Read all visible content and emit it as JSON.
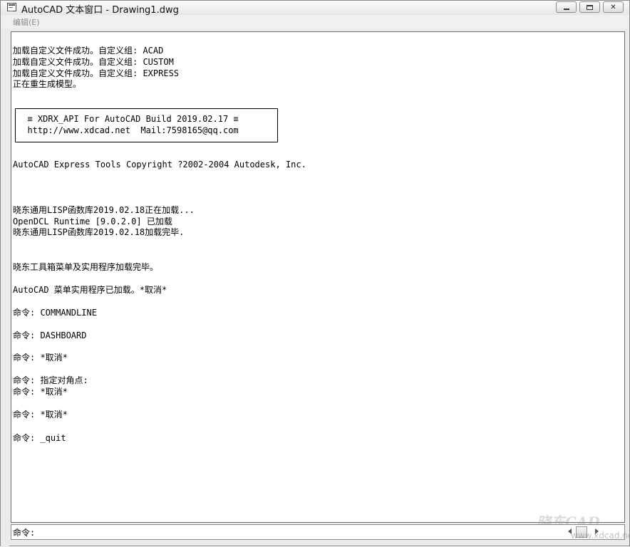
{
  "window": {
    "title": "AutoCAD 文本窗口 - Drawing1.dwg"
  },
  "menu": {
    "items": [
      "编辑(E)"
    ]
  },
  "history": {
    "lines": [
      "加载自定义文件成功。自定义组: ACAD",
      "加载自定义文件成功。自定义组: CUSTOM",
      "加载自定义文件成功。自定义组: EXPRESS",
      "正在重生成模型。",
      "  ≡ XDRX_API For AutoCAD Build 2019.02.17 ≡",
      "  http://www.xdcad.net  Mail:7598165@qq.com",
      "AutoCAD Express Tools Copyright ?2002-2004 Autodesk, Inc.",
      "晓东通用LISP函数库2019.02.18正在加载...",
      "OpenDCL Runtime [9.0.2.0] 已加载",
      "晓东通用LISP函数库2019.02.18加载完毕.",
      "晓东工具箱菜单及实用程序加载完毕。",
      "AutoCAD 菜单实用程序已加载。*取消*",
      "命令: COMMANDLINE",
      "命令: DASHBOARD",
      "命令: *取消*",
      "命令: 指定对角点:",
      "命令: *取消*",
      "命令: *取消*",
      "命令: _quit"
    ]
  },
  "command": {
    "prompt": "命令:"
  },
  "watermark": {
    "logo": "晓东CAD",
    "url": "www.xdcad.net"
  }
}
